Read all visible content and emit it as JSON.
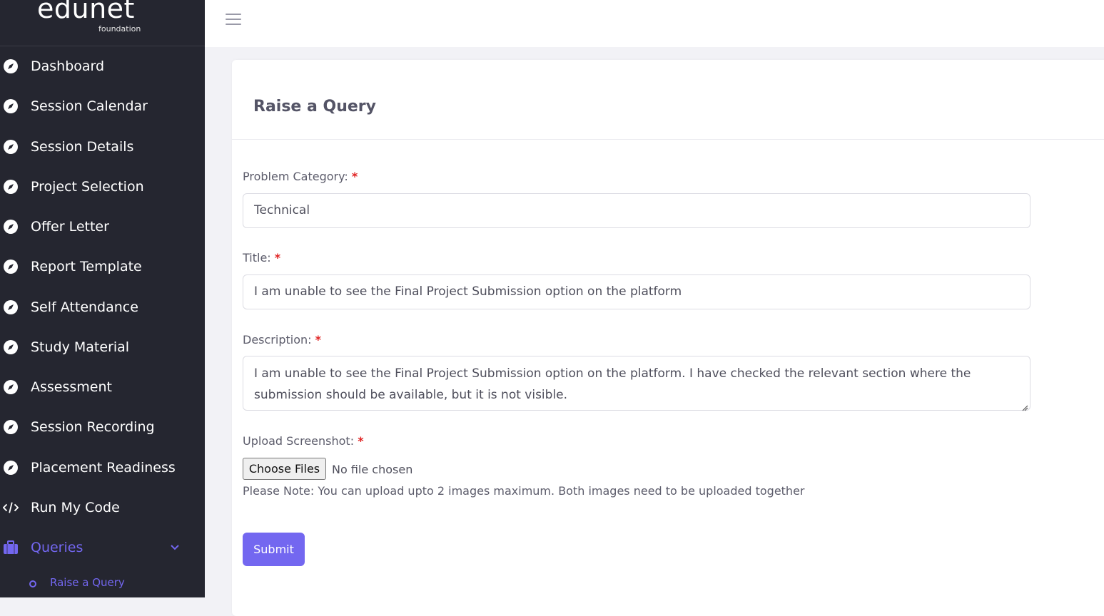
{
  "brand": {
    "name": "edunet",
    "tagline": "foundation"
  },
  "sidebar": {
    "items": [
      {
        "label": "Dashboard",
        "icon": "compass-icon"
      },
      {
        "label": "Session Calendar",
        "icon": "compass-icon"
      },
      {
        "label": "Session Details",
        "icon": "compass-icon"
      },
      {
        "label": "Project Selection",
        "icon": "compass-icon"
      },
      {
        "label": "Offer Letter",
        "icon": "compass-icon"
      },
      {
        "label": "Report Template",
        "icon": "compass-icon"
      },
      {
        "label": "Self Attendance",
        "icon": "compass-icon"
      },
      {
        "label": "Study Material",
        "icon": "compass-icon"
      },
      {
        "label": "Assessment",
        "icon": "compass-icon"
      },
      {
        "label": "Session Recording",
        "icon": "compass-icon"
      },
      {
        "label": "Placement Readiness",
        "icon": "compass-icon"
      },
      {
        "label": "Run My Code",
        "icon": "code-icon"
      },
      {
        "label": "Queries",
        "icon": "briefcase-icon",
        "active": true,
        "expanded": true
      }
    ],
    "subitems": [
      {
        "label": "Raise a Query",
        "active": true
      }
    ]
  },
  "topbar": {
    "menu_icon": "hamburger-menu-icon"
  },
  "form": {
    "title": "Raise a Query",
    "required_mark": "*",
    "category": {
      "label": "Problem Category:",
      "value": "Technical"
    },
    "title_field": {
      "label": "Title:",
      "value": "I am unable to see the Final Project Submission option on the platform"
    },
    "description": {
      "label": "Description:",
      "value": "I am unable to see the Final Project Submission option on the platform. I have checked the relevant section where the submission should be available, but it is not visible."
    },
    "upload": {
      "label": "Upload Screenshot:",
      "button": "Choose Files",
      "status": "No file chosen",
      "note": "Please Note: You can upload upto 2 images maximum. Both images need to be uploaded together"
    },
    "submit": "Submit"
  },
  "colors": {
    "sidebar_bg": "#252630",
    "accent": "#7367f0",
    "required": "#e02020",
    "page_bg": "#f2f2f6"
  }
}
